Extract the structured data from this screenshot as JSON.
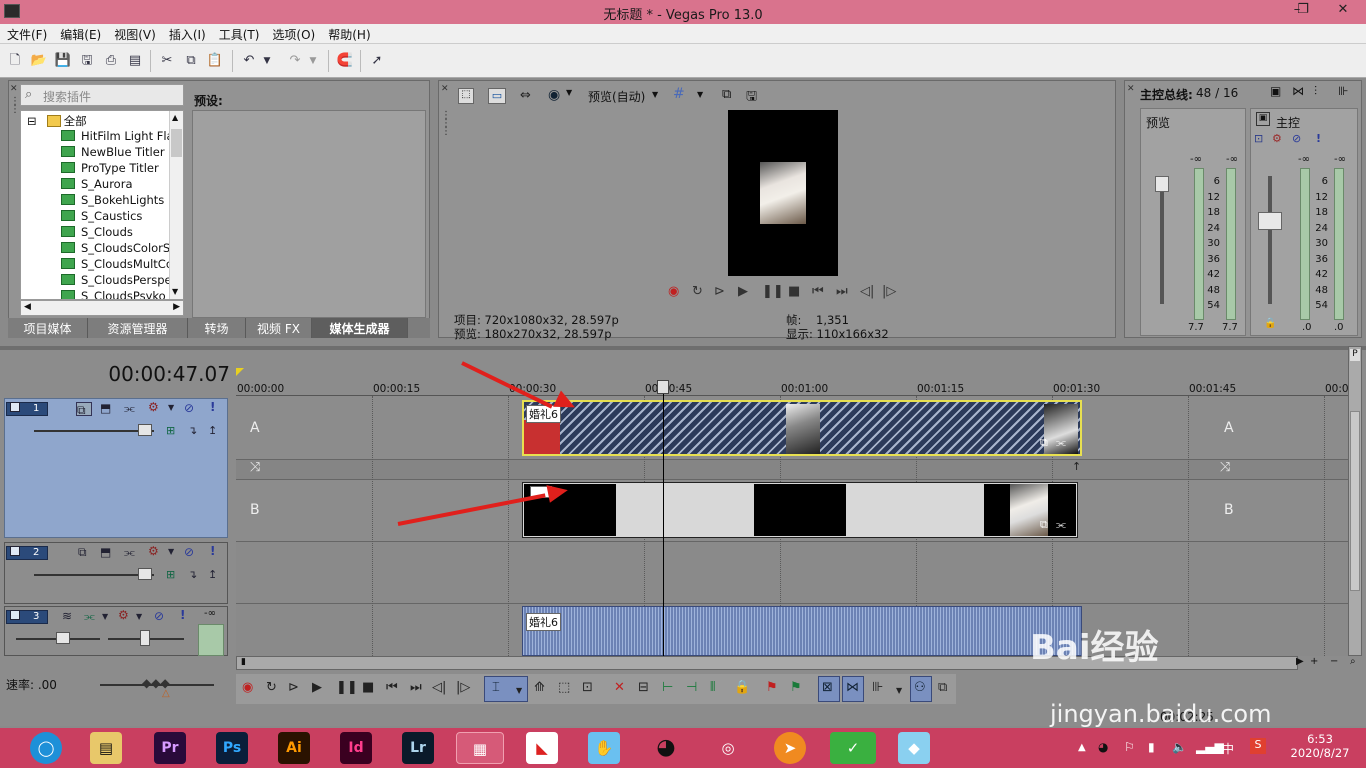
{
  "window": {
    "title": "无标题 * - Vegas Pro 13.0",
    "controls": [
      "–",
      "❐",
      "✕"
    ]
  },
  "menu": [
    "文件(F)",
    "编辑(E)",
    "视图(V)",
    "插入(I)",
    "工具(T)",
    "选项(O)",
    "帮助(H)"
  ],
  "plugins": {
    "search_placeholder": "搜索插件",
    "root": "全部",
    "items": [
      "HitFilm Light Fla",
      "NewBlue Titler P",
      "ProType Titler",
      "S_Aurora",
      "S_BokehLights",
      "S_Caustics",
      "S_Clouds",
      "S_CloudsColorS",
      "S_CloudsMultCo",
      "S_CloudsPerspe",
      "S_CloudsPsyko"
    ],
    "preset_label": "预设:"
  },
  "left_tabs": [
    "项目媒体",
    "资源管理器",
    "转场",
    "视频 FX",
    "媒体生成器"
  ],
  "preview": {
    "mode": "预览(自动)",
    "project_label": "项目:",
    "project_value": "720x1080x32, 28.597p",
    "preview_label": "预览:",
    "preview_value": "180x270x32, 28.597p",
    "frame_label": "帧:",
    "frame_value": "1,351",
    "display_label": "显示:",
    "display_value": "110x166x32"
  },
  "mixer": {
    "title": "主控总线:",
    "count": "48 / 16",
    "preview_label": "预览",
    "master_label": "主控",
    "neg_inf": "-∞",
    "scale": [
      "6",
      "12",
      "18",
      "24",
      "30",
      "36",
      "42",
      "48",
      "54"
    ],
    "bottom_left": "7.7",
    "bottom_right": ".0"
  },
  "timeline": {
    "time": "00:00:47.07",
    "ticks": [
      "00:00:00",
      "00:00:15",
      "00:00:30",
      "00:00:45",
      "00:01:00",
      "00:01:15",
      "00:01:30",
      "00:01:45",
      "00:0"
    ],
    "lane_a": "A",
    "lane_b": "B",
    "clip_label": "婚礼6",
    "tracks": [
      "1",
      "2",
      "3"
    ],
    "audio_db": "-∞",
    "rate_label": "速率: .00",
    "status_text": "00:02:25"
  },
  "taskbar": {
    "apps": [
      "Pr",
      "Ps",
      "Ai",
      "Id",
      "Lr"
    ],
    "time": "6:53",
    "date": "2020/8/27",
    "ime": "中"
  },
  "watermark": {
    "brand": "Bai经验",
    "url": "jingyan.baidu.com"
  }
}
